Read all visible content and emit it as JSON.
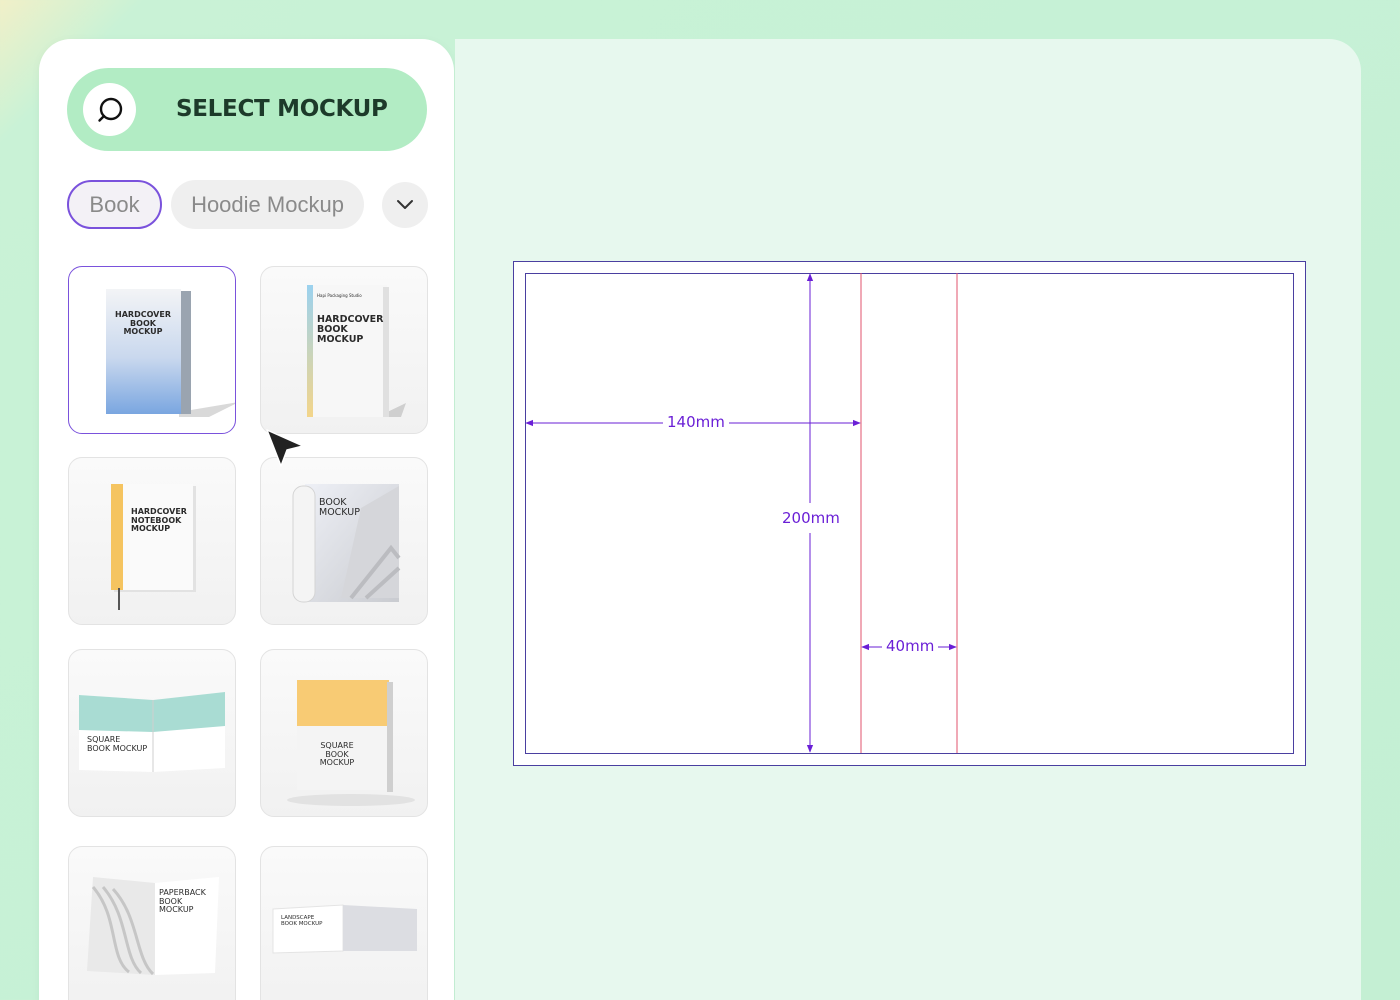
{
  "sidebar": {
    "select_button": {
      "label": "SELECT MOCKUP",
      "icon": "search-icon"
    },
    "filters": [
      {
        "label": "Book",
        "active": true
      },
      {
        "label": "Hoodie Mockup",
        "active": false
      }
    ],
    "more_filters_icon": "chevron-down-icon",
    "mockups": [
      {
        "title": "HARDCOVER\nBOOK\nMOCKUP",
        "selected": true
      },
      {
        "title": "HARDCOVER\nBOOK\nMOCKUP",
        "subtitle": "Hapi Packaging Studio",
        "selected": false
      },
      {
        "title": "HARDCOVER\nNOTEBOOK\nMOCKUP",
        "selected": false
      },
      {
        "title": "BOOK\nMOCKUP",
        "selected": false
      },
      {
        "title": "SQUARE\nBOOK MOCKUP",
        "selected": false
      },
      {
        "title": "SQUARE\nBOOK\nMOCKUP",
        "selected": false
      },
      {
        "title": "PAPERBACK\nBOOK\nMOCKUP",
        "selected": false
      },
      {
        "title": "LANDSCAPE\nBOOK MOCKUP",
        "selected": false
      }
    ]
  },
  "canvas": {
    "width_dimension": "140mm",
    "height_dimension": "200mm",
    "spine_dimension": "40mm"
  },
  "colors": {
    "accent": "#7a52dc",
    "dimension": "#6a1fd6",
    "fold_line": "#e0536d",
    "button_bg": "#b2ecc4"
  }
}
